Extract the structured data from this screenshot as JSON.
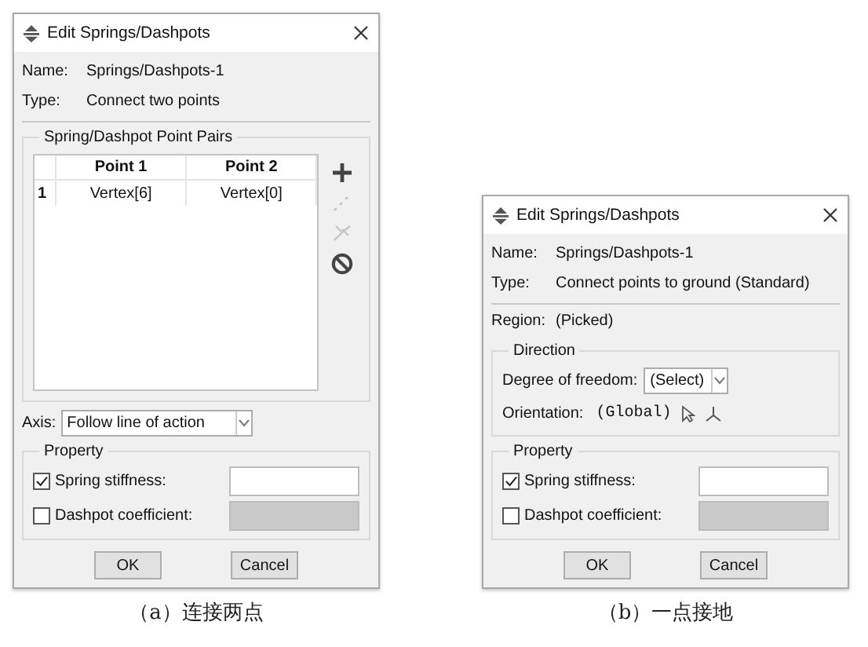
{
  "figures": [
    {
      "dialog": {
        "title": "Edit Springs/Dashpots",
        "name": {
          "label": "Name:",
          "value": "Springs/Dashpots-1"
        },
        "type": {
          "label": "Type:",
          "value": "Connect two points"
        },
        "point_pairs": {
          "title": "Spring/Dashpot Point Pairs",
          "columns": [
            "Point 1",
            "Point 2"
          ],
          "rows": [
            {
              "index": "1",
              "cells": [
                "Vertex[6]",
                "Vertex[0]"
              ]
            }
          ],
          "tools": [
            {
              "kind": "add",
              "disabled": false
            },
            {
              "kind": "edit",
              "disabled": true
            },
            {
              "kind": "delete",
              "disabled": true
            },
            {
              "kind": "clear",
              "disabled": false
            }
          ]
        },
        "axis": {
          "label": "Axis:",
          "value": "Follow line of action"
        },
        "property": {
          "title": "Property",
          "rows": [
            {
              "label": "Spring stiffness:",
              "checked": true
            },
            {
              "label": "Dashpot coefficient:",
              "checked": false
            }
          ]
        },
        "buttons": [
          "OK",
          "Cancel"
        ]
      },
      "caption": "（a）连接两点"
    },
    {
      "dialog": {
        "title": "Edit Springs/Dashpots",
        "name": {
          "label": "Name:",
          "value": "Springs/Dashpots-1"
        },
        "type": {
          "label": "Type:",
          "value": "Connect points to ground (Standard)"
        },
        "region": {
          "label": "Region:",
          "value": "(Picked)"
        },
        "direction": {
          "title": "Direction",
          "dof": {
            "label": "Degree of freedom:",
            "value": "(Select)"
          },
          "orientation": {
            "label": "Orientation:",
            "value": "(Global)"
          }
        },
        "property": {
          "title": "Property",
          "rows": [
            {
              "label": "Spring stiffness:",
              "checked": true
            },
            {
              "label": "Dashpot coefficient:",
              "checked": false
            }
          ]
        },
        "buttons": [
          "OK",
          "Cancel"
        ]
      },
      "caption": "（b）一点接地"
    }
  ]
}
